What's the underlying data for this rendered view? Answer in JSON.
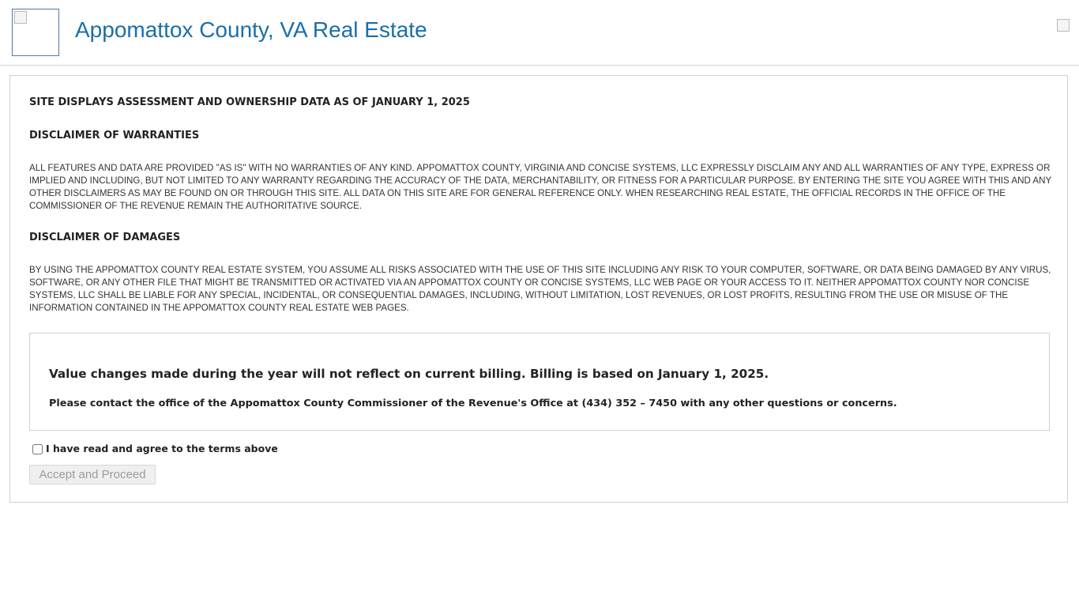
{
  "header": {
    "logo_icon": "broken-image-icon",
    "title": "Appomattox County, VA Real Estate",
    "corner_icon": "broken-image-icon"
  },
  "disclaimer": {
    "assessment_heading": "SITE DISPLAYS ASSESSMENT AND OWNERSHIP DATA AS OF JANUARY 1, 2025",
    "warranties_heading": "DISCLAIMER OF WARRANTIES",
    "warranties_text": "ALL FEATURES AND DATA ARE PROVIDED \"AS IS\" WITH NO WARRANTIES OF ANY KIND. APPOMATTOX COUNTY, VIRGINIA AND CONCISE SYSTEMS, LLC EXPRESSLY DISCLAIM ANY AND ALL WARRANTIES OF ANY TYPE, EXPRESS OR IMPLIED AND INCLUDING, BUT NOT LIMITED TO ANY WARRANTY REGARDING THE ACCURACY OF THE DATA, MERCHANTABILITY, OR FITNESS FOR A PARTICULAR PURPOSE. BY ENTERING THE SITE YOU AGREE WITH THIS AND ANY OTHER DISCLAIMERS AS MAY BE FOUND ON OR THROUGH THIS SITE. ALL DATA ON THIS SITE ARE FOR GENERAL REFERENCE ONLY. WHEN RESEARCHING REAL ESTATE, THE OFFICIAL RECORDS IN THE OFFICE OF THE COMMISSIONER OF THE REVENUE REMAIN THE AUTHORITATIVE SOURCE.",
    "damages_heading": "DISCLAIMER OF DAMAGES",
    "damages_text": "BY USING THE APPOMATTOX COUNTY REAL ESTATE SYSTEM, YOU ASSUME ALL RISKS ASSOCIATED WITH THE USE OF THIS SITE INCLUDING ANY RISK TO YOUR COMPUTER, SOFTWARE, OR DATA BEING DAMAGED BY ANY VIRUS, SOFTWARE, OR ANY OTHER FILE THAT MIGHT BE TRANSMITTED OR ACTIVATED VIA AN APPOMATTOX COUNTY OR CONCISE SYSTEMS, LLC WEB PAGE OR YOUR ACCESS TO IT. NEITHER APPOMATTOX COUNTY NOR CONCISE SYSTEMS, LLC SHALL BE LIABLE FOR ANY SPECIAL, INCIDENTAL, OR CONSEQUENTIAL DAMAGES, INCLUDING, WITHOUT LIMITATION, LOST REVENUES, OR LOST PROFITS, RESULTING FROM THE USE OR MISUSE OF THE INFORMATION CONTAINED IN THE APPOMATTOX COUNTY REAL ESTATE WEB PAGES."
  },
  "notice": {
    "main": "Value changes made during the year will not reflect on current billing. Billing is based on January 1, 2025.",
    "contact": "Please contact the office of the Appomattox County Commissioner of the Revenue's Office at (434) 352 – 7450 with any other questions or concerns."
  },
  "agreement": {
    "checkbox_label": "I have read and agree to the terms above",
    "checked": false,
    "proceed_label": "Accept and Proceed",
    "proceed_enabled": false
  }
}
